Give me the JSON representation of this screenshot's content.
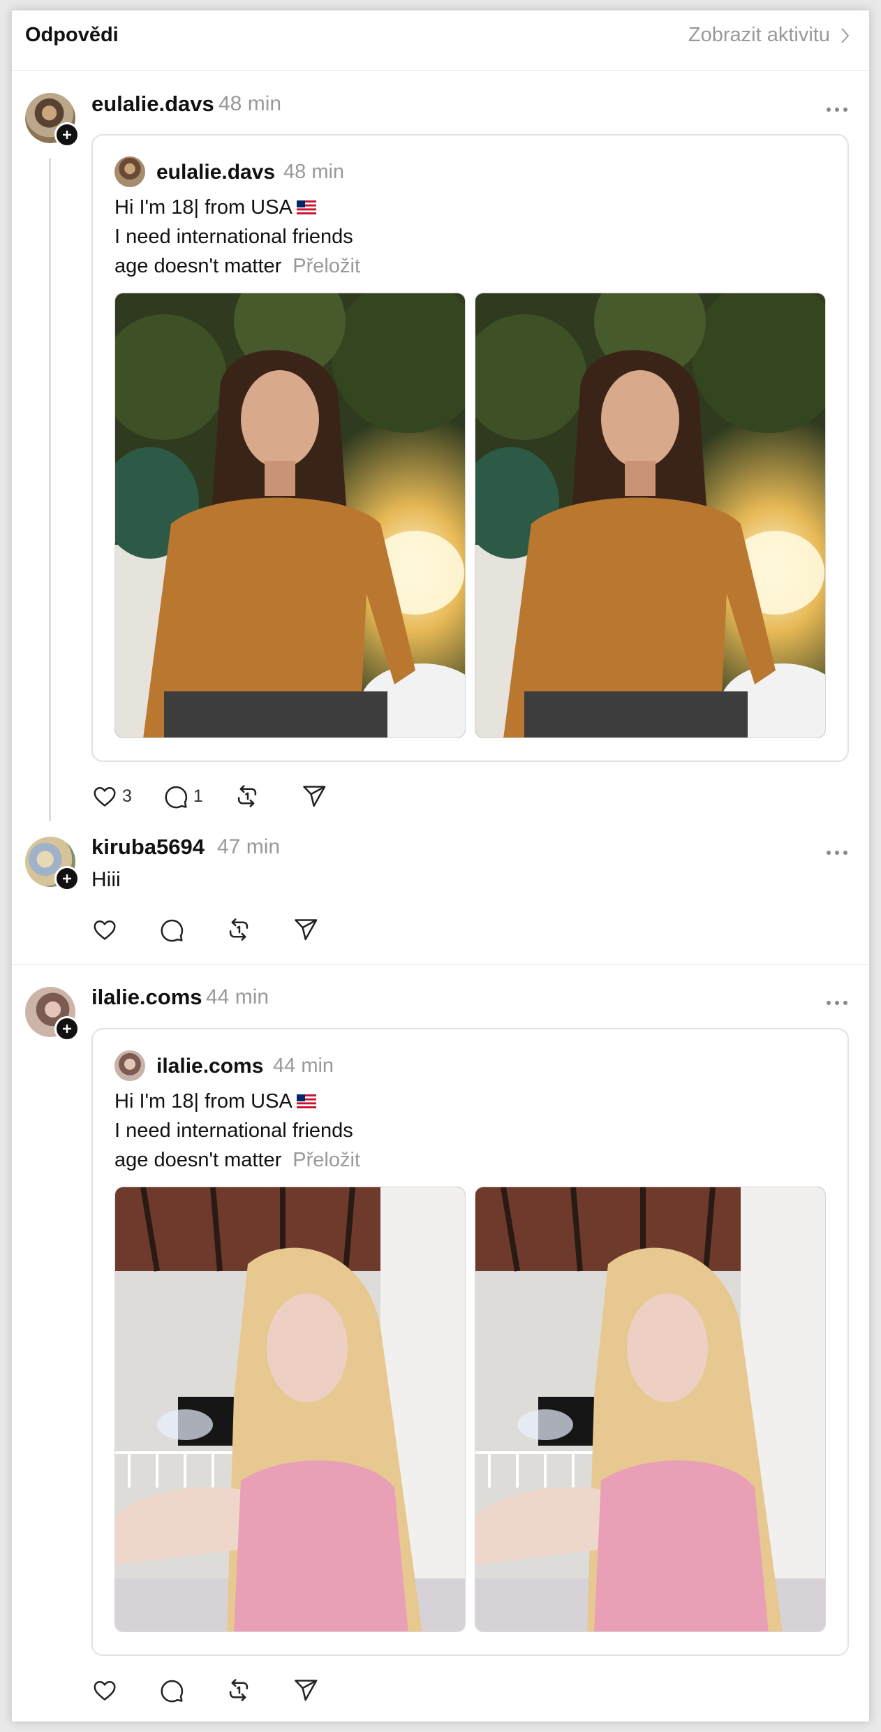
{
  "header": {
    "title": "Odpovědi",
    "link_label": "Zobrazit aktivitu"
  },
  "posts": [
    {
      "username": "eulalie.davs",
      "time": "48 min",
      "quote": {
        "username": "eulalie.davs",
        "time": "48 min",
        "lines": [
          "Hi I'm 18| from USA",
          "I need international friends",
          "age doesn't matter"
        ],
        "translate_label": "Přeložit"
      },
      "likes": "3",
      "comments": "1"
    },
    {
      "username": "kiruba5694",
      "time": "47 min",
      "text": "Hiii"
    },
    {
      "username": "ilalie.coms",
      "time": "44 min",
      "quote": {
        "username": "ilalie.coms",
        "time": "44 min",
        "lines": [
          "Hi I'm 18| from USA",
          "I need international friends",
          "age doesn't matter"
        ],
        "translate_label": "Přeložit"
      }
    }
  ],
  "icons": {
    "like": "heart-icon",
    "comment": "comment-bubble-icon",
    "repost": "repost-icon",
    "share": "send-icon",
    "more": "more-dots-icon",
    "follow": "plus-icon",
    "flag": "us-flag-icon"
  },
  "colors": {
    "text": "#111111",
    "muted": "#999999",
    "border": "#e2e2e2"
  }
}
